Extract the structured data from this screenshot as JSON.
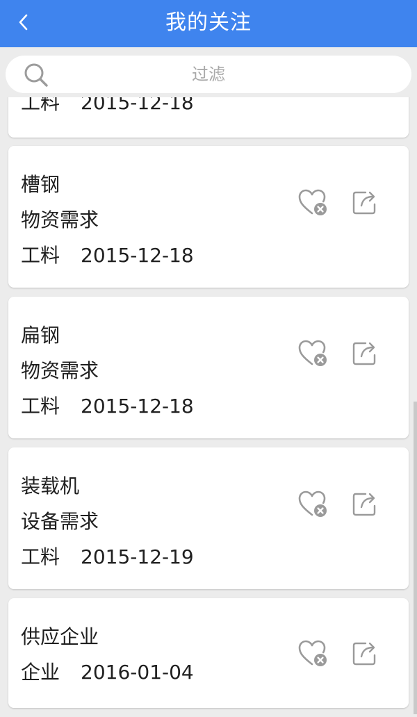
{
  "header": {
    "title": "我的关注"
  },
  "search": {
    "placeholder": "过滤"
  },
  "items": [
    {
      "name": "",
      "type": "",
      "dept": "工料",
      "date": "2015-12-18"
    },
    {
      "name": "槽钢",
      "type": "物资需求",
      "dept": "工料",
      "date": "2015-12-18"
    },
    {
      "name": "扁钢",
      "type": "物资需求",
      "dept": "工料",
      "date": "2015-12-18"
    },
    {
      "name": "装载机",
      "type": "设备需求",
      "dept": "工料",
      "date": "2015-12-19"
    },
    {
      "name": "供应企业",
      "type": "企业",
      "date": "2016-01-04"
    }
  ],
  "icons": {
    "back": "chevron-left-icon",
    "search": "search-icon",
    "unfavorite": "heart-remove-icon",
    "share": "share-icon"
  },
  "colors": {
    "header": "#3f84ee",
    "background": "#ececec",
    "icon": "#9a9a9a"
  }
}
